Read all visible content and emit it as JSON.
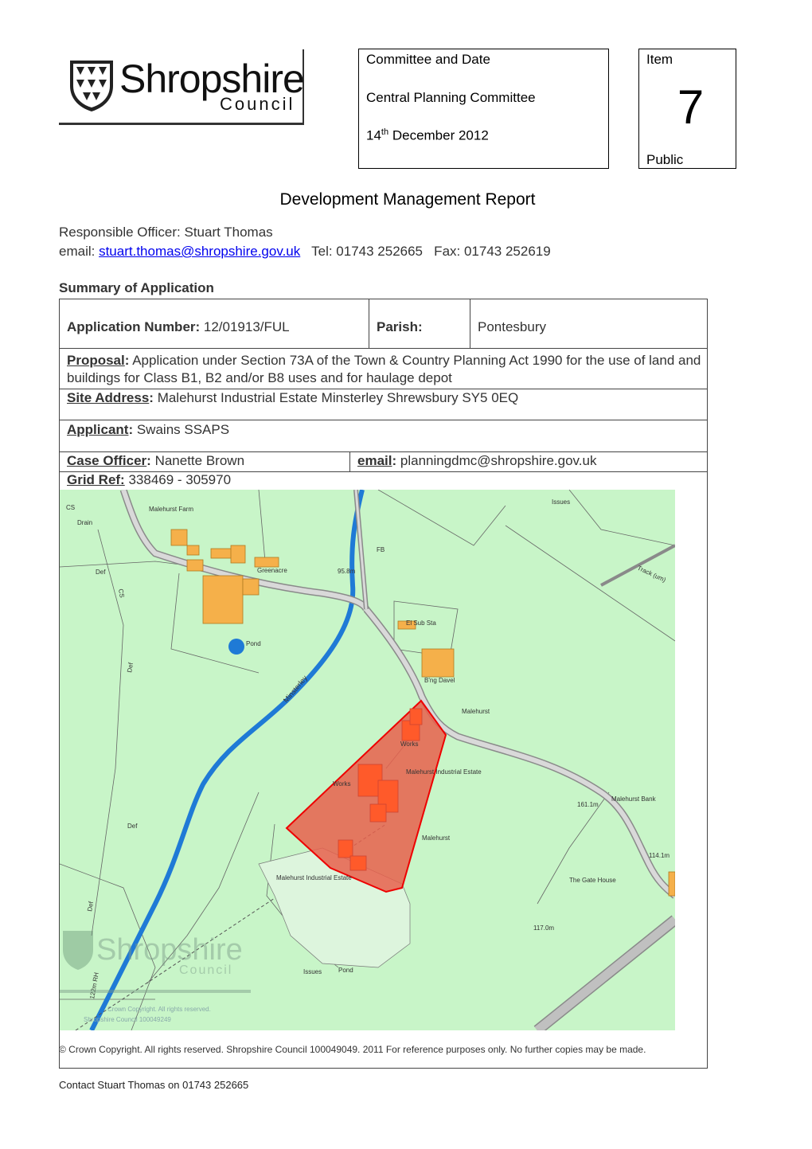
{
  "header": {
    "logo": {
      "name": "Shropshire",
      "sub": "Council"
    },
    "committee": {
      "label": "Committee and Date",
      "committee_name": "Central Planning Committee",
      "date_day": "14",
      "date_suffix": "th",
      "date_rest": " December 2012"
    },
    "item": {
      "label": "Item",
      "number": "7",
      "status": "Public"
    }
  },
  "title": "Development Management Report",
  "officer": {
    "responsible": "Responsible Officer: Stuart Thomas",
    "email_label": "email: ",
    "email": "stuart.thomas@shropshire.gov.uk",
    "tel": "   Tel: 01743 252665   Fax: 01743 252619"
  },
  "summary_heading": "Summary of Application",
  "application": {
    "number_label": "Application Number:",
    "number": " 12/01913/FUL",
    "parish_label": "Parish:",
    "parish": "Pontesbury",
    "proposal_label": "Proposal",
    "proposal_colon": ":",
    "proposal": " Application under Section 73A of the Town & Country Planning Act 1990 for the use of land and buildings for Class B1, B2 and/or B8 uses and for haulage depot",
    "site_label": "Site Address",
    "site_colon": ":",
    "site": " Malehurst Industrial Estate Minsterley Shrewsbury SY5 0EQ",
    "applicant_label": "Applicant",
    "applicant_colon": ":",
    "applicant": " Swains SSAPS",
    "case_label": "Case Officer",
    "case_colon": ":",
    "case_officer": " Nanette Brown",
    "case_email_label": "email",
    "case_email_colon": ":",
    "case_email": " planningdmc@shropshire.gov.uk",
    "grid_label": "Grid Ref:",
    "grid": " 338469 - 305970"
  },
  "map": {
    "labels": [
      "CS",
      "Drain",
      "Malehurst Farm",
      "Issues",
      "FB",
      "Def",
      "CS",
      "Greenacre",
      "95.8m",
      "Track (um)",
      "Pond",
      "El Sub Sta",
      "Def",
      "Minsterley",
      "B'ng Davel",
      "Malehurst",
      "Works",
      "Malehurst Industrial Estate",
      "Works",
      "161.1m",
      "Malehurst Bank",
      "Def",
      "Malehurst",
      "114.1m",
      "Malehurst Industrial Estate",
      "The Gate House",
      "Def",
      "117.0m",
      "Pond",
      "Issues",
      "122m RH",
      "Crown Copyright. All rights reserved.",
      "Shropshire Council 100049249"
    ],
    "watermark": {
      "name": "Shropshire",
      "sub": "Council"
    }
  },
  "copyright": "© Crown Copyright. All rights reserved.  Shropshire Council 100049049. 2011 For reference purposes only. No further copies may be made.",
  "contact": "Contact Stuart Thomas on 01743 252665",
  "colors": {
    "site_red": "#e8604c",
    "map_green": "#c8f5c8",
    "river_blue": "#1f7ad6",
    "road_grey": "#b0b0b0",
    "building_orange": "#f5b04a"
  }
}
